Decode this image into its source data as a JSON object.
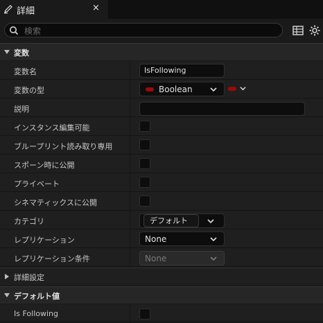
{
  "tab": {
    "title": "詳細",
    "close": "×"
  },
  "search": {
    "placeholder": "検索",
    "value": ""
  },
  "sections": {
    "variables": "変数",
    "advanced": "詳細設定",
    "default_value": "デフォルト値"
  },
  "rows": {
    "var_name": {
      "label": "変数名",
      "value": "IsFollowing"
    },
    "var_type": {
      "label": "変数の型",
      "value": "Boolean",
      "type_color": "#9a0a0a"
    },
    "description": {
      "label": "説明",
      "value": ""
    },
    "instance_editable": {
      "label": "インスタンス編集可能"
    },
    "blueprint_readonly": {
      "label": "ブループリント読み取り専用"
    },
    "expose_on_spawn": {
      "label": "スポーン時に公開"
    },
    "private": {
      "label": "プライベート"
    },
    "expose_to_cinematics": {
      "label": "シネマティックスに公開"
    },
    "category": {
      "label": "カテゴリ",
      "value": "デフォルト"
    },
    "replication": {
      "label": "レプリケーション",
      "value": "None"
    },
    "replication_condition": {
      "label": "レプリケーション条件",
      "value": "None"
    },
    "is_following": {
      "label": "Is Following"
    }
  },
  "icons": {
    "tab": "pencil-icon",
    "search": "search-icon",
    "table_view": "table-icon",
    "settings": "gear-icon"
  }
}
